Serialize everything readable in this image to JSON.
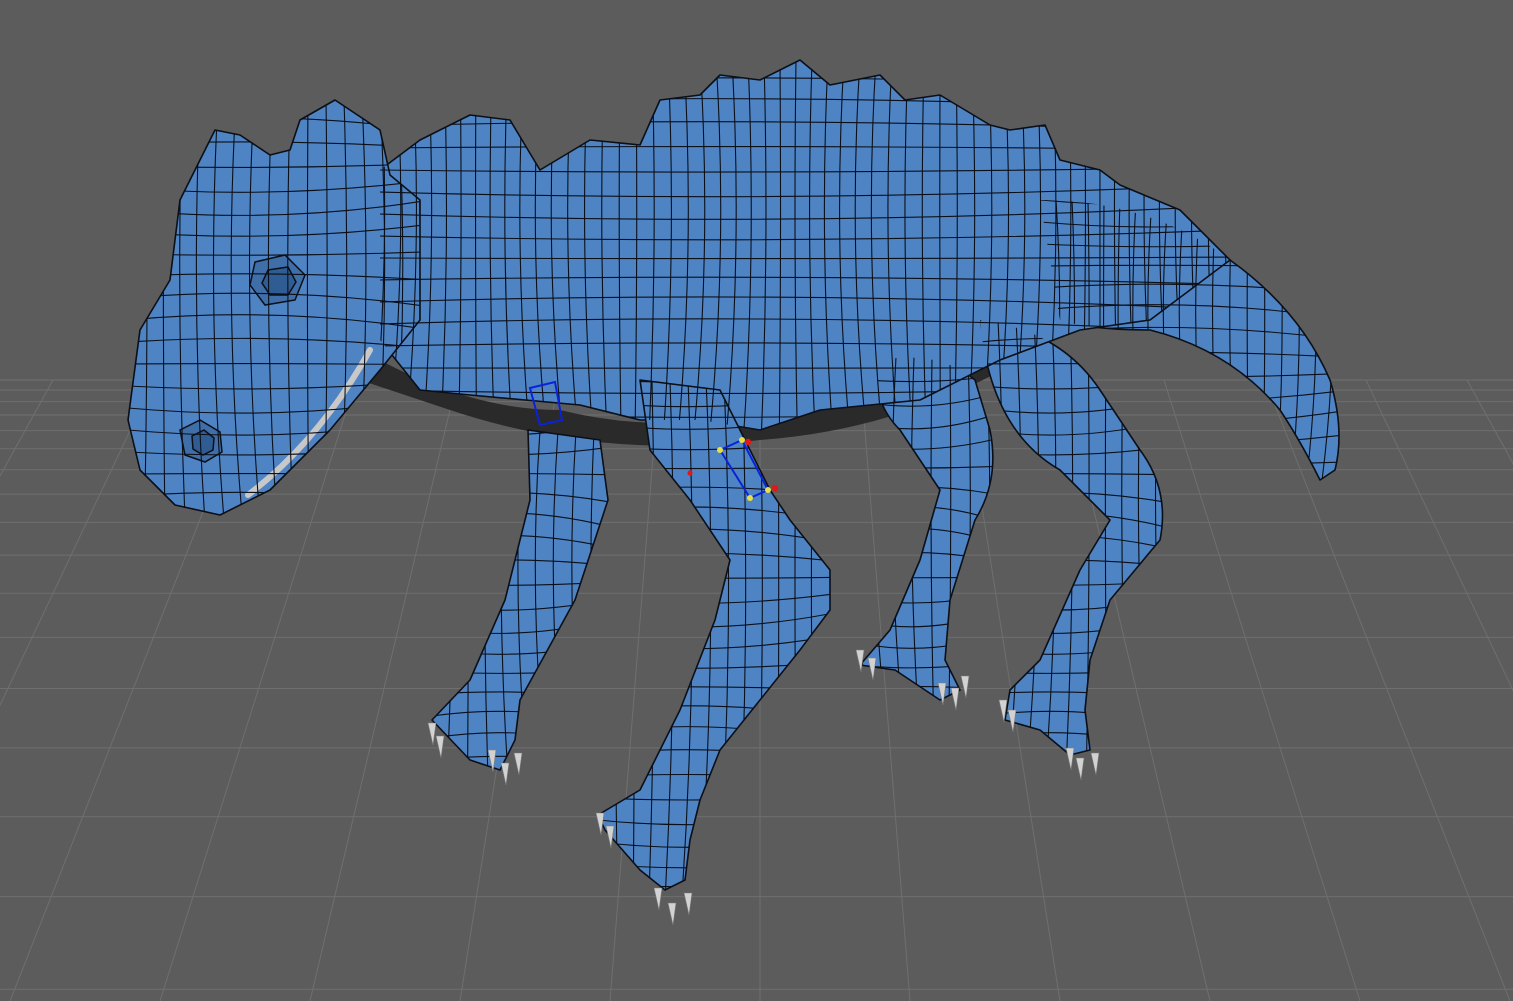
{
  "viewport": {
    "background": "#5c5c5c",
    "grid_color": "#6f6f6f",
    "grid_line_count": 26
  },
  "model": {
    "surface_color": "#4f84c4",
    "surface_shade": "#3f6ea8",
    "wire_color": "#0b0f18",
    "claw_color": "#d2d2d2",
    "under_color": "#2a2a2a"
  },
  "selection": {
    "face_outline_color": "#0a22d8",
    "vertex_color": "#e8e048",
    "vertex_active_color": "#e01818"
  }
}
